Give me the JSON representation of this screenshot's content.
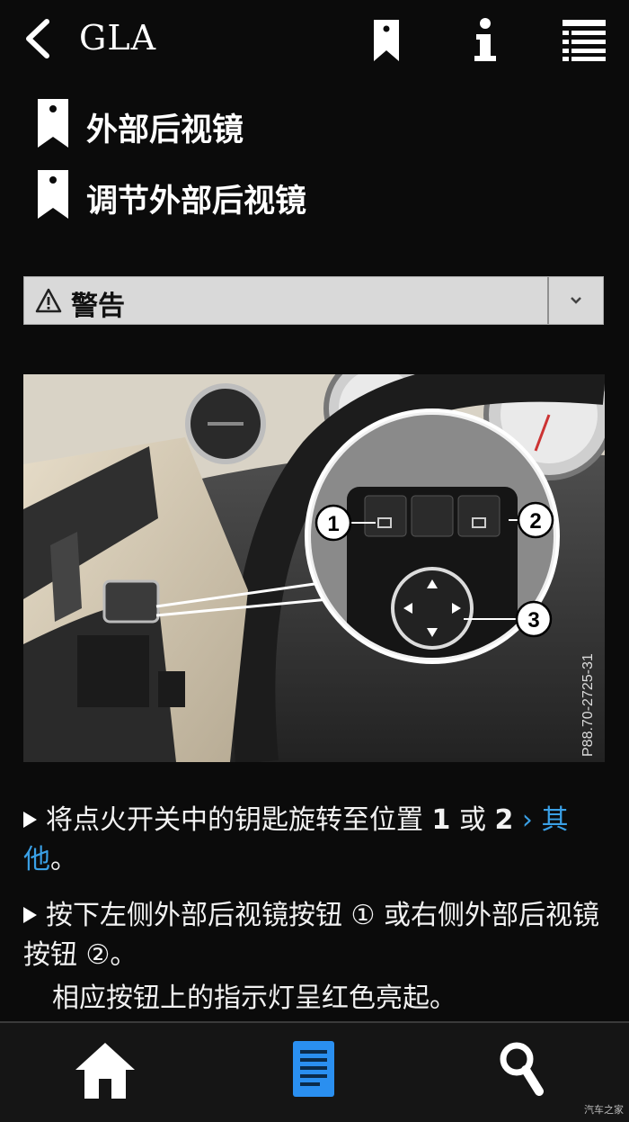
{
  "header": {
    "title": "GLA"
  },
  "breadcrumbs": [
    "外部后视镜",
    "调节外部后视镜"
  ],
  "warning": {
    "label": "警告"
  },
  "figure": {
    "code": "P88.70-2725-31",
    "callouts": [
      "1",
      "2",
      "3"
    ]
  },
  "steps": [
    {
      "before": "将点火开关中的钥匙旋转至位置 ",
      "pos1": "1",
      "or": " 或 ",
      "pos2": "2",
      "link": "其他",
      "after": "。"
    },
    {
      "text": "按下左侧外部后视镜按钮 ① 或右侧外部后视镜按钮 ②。"
    }
  ],
  "result": "相应按钮上的指示灯呈红色亮起。",
  "watermark": "汽车之家",
  "colors": {
    "background": "#0b0b0b",
    "link": "#3aa0e6",
    "active_tab": "#2a8ff0"
  }
}
